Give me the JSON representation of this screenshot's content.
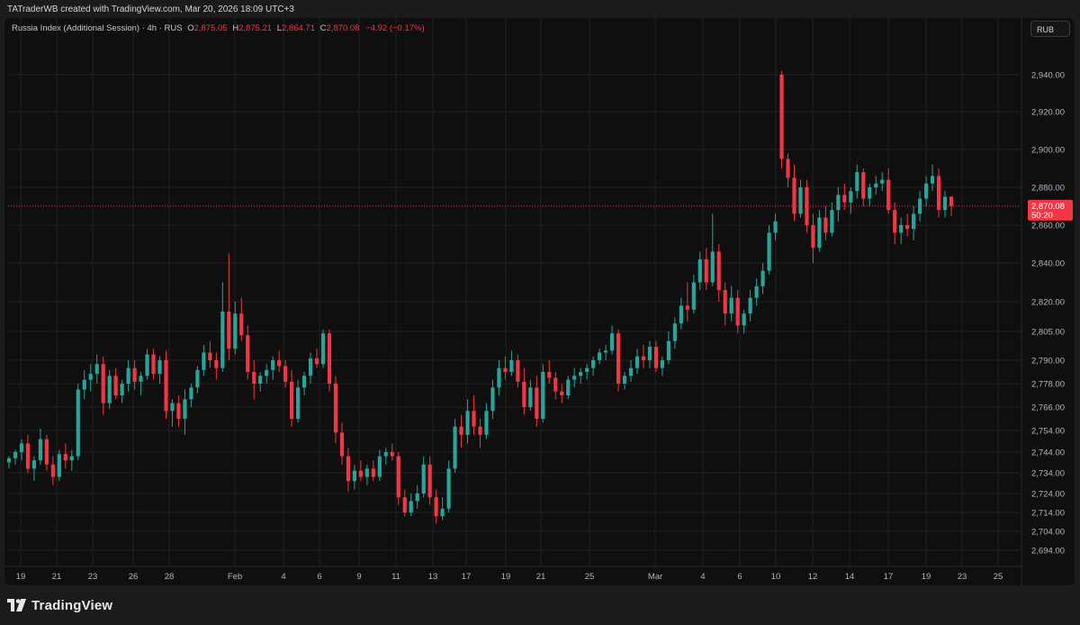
{
  "header": {
    "attribution": "TATraderWB created with TradingView.com, Mar 20, 2026 18:09 UTC+3"
  },
  "legend": {
    "symbol": "Russia Index (Additional Session) · 4h · RUS",
    "open_label": "O",
    "open": "2,875.05",
    "high_label": "H",
    "high": "2,875.21",
    "low_label": "L",
    "low": "2,864.71",
    "close_label": "C",
    "close": "2,870.08",
    "change": "−4.92 (−0.17%)"
  },
  "currency_button": "RUB",
  "price_tag": {
    "price": "2,870.08",
    "countdown": "50:20"
  },
  "footer": {
    "logo_text": "TradingView"
  },
  "colors": {
    "up": "#26a69a",
    "down": "#f23645",
    "background": "#0f0f0f",
    "grid": "#222222"
  },
  "chart_data": {
    "type": "candlestick",
    "y_axis_ticks": [
      "2,694.00",
      "2,704.00",
      "2,714.00",
      "2,724.00",
      "2,734.00",
      "2,744.00",
      "2,754.00",
      "2,766.00",
      "2,778.00",
      "2,790.00",
      "2,805.00",
      "2,820.00",
      "2,840.00",
      "2,860.00",
      "2,880.00",
      "2,900.00",
      "2,920.00",
      "2,940.00"
    ],
    "x_axis_ticks": [
      "19",
      "21",
      "23",
      "26",
      "28",
      "Feb",
      "4",
      "6",
      "9",
      "11",
      "13",
      "17",
      "19",
      "21",
      "25",
      "Mar",
      "4",
      "6",
      "10",
      "12",
      "14",
      "17",
      "19",
      "23",
      "25"
    ],
    "last_price": 2870.08,
    "series": [
      {
        "o": 2739,
        "h": 2742,
        "l": 2736,
        "c": 2741
      },
      {
        "o": 2741,
        "h": 2745,
        "l": 2738,
        "c": 2744
      },
      {
        "o": 2744,
        "h": 2750,
        "l": 2740,
        "c": 2748
      },
      {
        "o": 2748,
        "h": 2752,
        "l": 2734,
        "c": 2736
      },
      {
        "o": 2736,
        "h": 2742,
        "l": 2730,
        "c": 2740
      },
      {
        "o": 2740,
        "h": 2755,
        "l": 2738,
        "c": 2750
      },
      {
        "o": 2750,
        "h": 2752,
        "l": 2735,
        "c": 2738
      },
      {
        "o": 2738,
        "h": 2742,
        "l": 2728,
        "c": 2732
      },
      {
        "o": 2732,
        "h": 2745,
        "l": 2730,
        "c": 2743
      },
      {
        "o": 2743,
        "h": 2748,
        "l": 2736,
        "c": 2740
      },
      {
        "o": 2740,
        "h": 2745,
        "l": 2735,
        "c": 2742
      },
      {
        "o": 2742,
        "h": 2778,
        "l": 2740,
        "c": 2775
      },
      {
        "o": 2775,
        "h": 2785,
        "l": 2770,
        "c": 2780
      },
      {
        "o": 2780,
        "h": 2788,
        "l": 2774,
        "c": 2783
      },
      {
        "o": 2783,
        "h": 2793,
        "l": 2778,
        "c": 2788
      },
      {
        "o": 2788,
        "h": 2792,
        "l": 2762,
        "c": 2768
      },
      {
        "o": 2768,
        "h": 2785,
        "l": 2765,
        "c": 2782
      },
      {
        "o": 2782,
        "h": 2786,
        "l": 2770,
        "c": 2772
      },
      {
        "o": 2772,
        "h": 2780,
        "l": 2768,
        "c": 2778
      },
      {
        "o": 2778,
        "h": 2790,
        "l": 2774,
        "c": 2786
      },
      {
        "o": 2786,
        "h": 2790,
        "l": 2775,
        "c": 2779
      },
      {
        "o": 2779,
        "h": 2784,
        "l": 2772,
        "c": 2782
      },
      {
        "o": 2782,
        "h": 2796,
        "l": 2780,
        "c": 2793
      },
      {
        "o": 2793,
        "h": 2796,
        "l": 2780,
        "c": 2783
      },
      {
        "o": 2783,
        "h": 2792,
        "l": 2778,
        "c": 2790
      },
      {
        "o": 2790,
        "h": 2795,
        "l": 2760,
        "c": 2764
      },
      {
        "o": 2764,
        "h": 2770,
        "l": 2756,
        "c": 2768
      },
      {
        "o": 2768,
        "h": 2772,
        "l": 2756,
        "c": 2760
      },
      {
        "o": 2760,
        "h": 2775,
        "l": 2752,
        "c": 2770
      },
      {
        "o": 2770,
        "h": 2778,
        "l": 2766,
        "c": 2776
      },
      {
        "o": 2776,
        "h": 2787,
        "l": 2773,
        "c": 2785
      },
      {
        "o": 2785,
        "h": 2798,
        "l": 2782,
        "c": 2794
      },
      {
        "o": 2794,
        "h": 2800,
        "l": 2786,
        "c": 2790
      },
      {
        "o": 2790,
        "h": 2794,
        "l": 2780,
        "c": 2786
      },
      {
        "o": 2786,
        "h": 2830,
        "l": 2784,
        "c": 2815
      },
      {
        "o": 2815,
        "h": 2845,
        "l": 2790,
        "c": 2796
      },
      {
        "o": 2796,
        "h": 2820,
        "l": 2793,
        "c": 2814
      },
      {
        "o": 2814,
        "h": 2822,
        "l": 2800,
        "c": 2803
      },
      {
        "o": 2803,
        "h": 2808,
        "l": 2780,
        "c": 2784
      },
      {
        "o": 2784,
        "h": 2790,
        "l": 2770,
        "c": 2778
      },
      {
        "o": 2778,
        "h": 2784,
        "l": 2774,
        "c": 2782
      },
      {
        "o": 2782,
        "h": 2788,
        "l": 2778,
        "c": 2785
      },
      {
        "o": 2785,
        "h": 2792,
        "l": 2780,
        "c": 2790
      },
      {
        "o": 2790,
        "h": 2795,
        "l": 2784,
        "c": 2787
      },
      {
        "o": 2787,
        "h": 2790,
        "l": 2776,
        "c": 2779
      },
      {
        "o": 2779,
        "h": 2785,
        "l": 2756,
        "c": 2760
      },
      {
        "o": 2760,
        "h": 2780,
        "l": 2758,
        "c": 2776
      },
      {
        "o": 2776,
        "h": 2784,
        "l": 2772,
        "c": 2782
      },
      {
        "o": 2782,
        "h": 2794,
        "l": 2778,
        "c": 2791
      },
      {
        "o": 2791,
        "h": 2796,
        "l": 2786,
        "c": 2788
      },
      {
        "o": 2788,
        "h": 2806,
        "l": 2786,
        "c": 2804
      },
      {
        "o": 2804,
        "h": 2806,
        "l": 2774,
        "c": 2778
      },
      {
        "o": 2778,
        "h": 2782,
        "l": 2748,
        "c": 2753
      },
      {
        "o": 2753,
        "h": 2758,
        "l": 2738,
        "c": 2742
      },
      {
        "o": 2742,
        "h": 2746,
        "l": 2725,
        "c": 2730
      },
      {
        "o": 2730,
        "h": 2738,
        "l": 2726,
        "c": 2735
      },
      {
        "o": 2735,
        "h": 2740,
        "l": 2730,
        "c": 2732
      },
      {
        "o": 2732,
        "h": 2738,
        "l": 2728,
        "c": 2736
      },
      {
        "o": 2736,
        "h": 2740,
        "l": 2730,
        "c": 2732
      },
      {
        "o": 2732,
        "h": 2745,
        "l": 2730,
        "c": 2742
      },
      {
        "o": 2742,
        "h": 2746,
        "l": 2738,
        "c": 2744
      },
      {
        "o": 2744,
        "h": 2748,
        "l": 2740,
        "c": 2742
      },
      {
        "o": 2742,
        "h": 2744,
        "l": 2718,
        "c": 2722
      },
      {
        "o": 2722,
        "h": 2726,
        "l": 2712,
        "c": 2714
      },
      {
        "o": 2714,
        "h": 2724,
        "l": 2712,
        "c": 2720
      },
      {
        "o": 2720,
        "h": 2728,
        "l": 2716,
        "c": 2724
      },
      {
        "o": 2724,
        "h": 2742,
        "l": 2722,
        "c": 2738
      },
      {
        "o": 2738,
        "h": 2742,
        "l": 2718,
        "c": 2722
      },
      {
        "o": 2722,
        "h": 2726,
        "l": 2708,
        "c": 2712
      },
      {
        "o": 2712,
        "h": 2722,
        "l": 2710,
        "c": 2716
      },
      {
        "o": 2716,
        "h": 2740,
        "l": 2714,
        "c": 2736
      },
      {
        "o": 2736,
        "h": 2760,
        "l": 2734,
        "c": 2756
      },
      {
        "o": 2756,
        "h": 2762,
        "l": 2746,
        "c": 2752
      },
      {
        "o": 2752,
        "h": 2770,
        "l": 2748,
        "c": 2764
      },
      {
        "o": 2764,
        "h": 2772,
        "l": 2752,
        "c": 2756
      },
      {
        "o": 2756,
        "h": 2760,
        "l": 2746,
        "c": 2752
      },
      {
        "o": 2752,
        "h": 2768,
        "l": 2750,
        "c": 2764
      },
      {
        "o": 2764,
        "h": 2780,
        "l": 2760,
        "c": 2776
      },
      {
        "o": 2776,
        "h": 2790,
        "l": 2772,
        "c": 2786
      },
      {
        "o": 2786,
        "h": 2792,
        "l": 2780,
        "c": 2784
      },
      {
        "o": 2784,
        "h": 2795,
        "l": 2782,
        "c": 2790
      },
      {
        "o": 2790,
        "h": 2793,
        "l": 2776,
        "c": 2779
      },
      {
        "o": 2779,
        "h": 2786,
        "l": 2762,
        "c": 2766
      },
      {
        "o": 2766,
        "h": 2780,
        "l": 2764,
        "c": 2776
      },
      {
        "o": 2776,
        "h": 2782,
        "l": 2756,
        "c": 2760
      },
      {
        "o": 2760,
        "h": 2788,
        "l": 2758,
        "c": 2784
      },
      {
        "o": 2784,
        "h": 2790,
        "l": 2778,
        "c": 2781
      },
      {
        "o": 2781,
        "h": 2784,
        "l": 2770,
        "c": 2774
      },
      {
        "o": 2774,
        "h": 2778,
        "l": 2768,
        "c": 2772
      },
      {
        "o": 2772,
        "h": 2782,
        "l": 2770,
        "c": 2780
      },
      {
        "o": 2780,
        "h": 2786,
        "l": 2776,
        "c": 2782
      },
      {
        "o": 2782,
        "h": 2786,
        "l": 2778,
        "c": 2784
      },
      {
        "o": 2784,
        "h": 2788,
        "l": 2780,
        "c": 2786
      },
      {
        "o": 2786,
        "h": 2792,
        "l": 2782,
        "c": 2790
      },
      {
        "o": 2790,
        "h": 2796,
        "l": 2788,
        "c": 2794
      },
      {
        "o": 2794,
        "h": 2798,
        "l": 2790,
        "c": 2795
      },
      {
        "o": 2795,
        "h": 2808,
        "l": 2793,
        "c": 2804
      },
      {
        "o": 2804,
        "h": 2806,
        "l": 2774,
        "c": 2778
      },
      {
        "o": 2778,
        "h": 2784,
        "l": 2775,
        "c": 2782
      },
      {
        "o": 2782,
        "h": 2790,
        "l": 2779,
        "c": 2786
      },
      {
        "o": 2786,
        "h": 2796,
        "l": 2783,
        "c": 2792
      },
      {
        "o": 2792,
        "h": 2798,
        "l": 2786,
        "c": 2790
      },
      {
        "o": 2790,
        "h": 2800,
        "l": 2786,
        "c": 2797
      },
      {
        "o": 2797,
        "h": 2800,
        "l": 2784,
        "c": 2786
      },
      {
        "o": 2786,
        "h": 2792,
        "l": 2782,
        "c": 2790
      },
      {
        "o": 2790,
        "h": 2805,
        "l": 2788,
        "c": 2800
      },
      {
        "o": 2800,
        "h": 2812,
        "l": 2796,
        "c": 2809
      },
      {
        "o": 2809,
        "h": 2822,
        "l": 2806,
        "c": 2818
      },
      {
        "o": 2818,
        "h": 2830,
        "l": 2810,
        "c": 2816
      },
      {
        "o": 2816,
        "h": 2834,
        "l": 2814,
        "c": 2830
      },
      {
        "o": 2830,
        "h": 2846,
        "l": 2826,
        "c": 2842
      },
      {
        "o": 2842,
        "h": 2848,
        "l": 2826,
        "c": 2830
      },
      {
        "o": 2830,
        "h": 2866,
        "l": 2828,
        "c": 2846
      },
      {
        "o": 2846,
        "h": 2850,
        "l": 2820,
        "c": 2826
      },
      {
        "o": 2826,
        "h": 2830,
        "l": 2808,
        "c": 2814
      },
      {
        "o": 2814,
        "h": 2828,
        "l": 2810,
        "c": 2822
      },
      {
        "o": 2822,
        "h": 2826,
        "l": 2804,
        "c": 2808
      },
      {
        "o": 2808,
        "h": 2816,
        "l": 2804,
        "c": 2814
      },
      {
        "o": 2814,
        "h": 2826,
        "l": 2810,
        "c": 2822
      },
      {
        "o": 2822,
        "h": 2832,
        "l": 2818,
        "c": 2828
      },
      {
        "o": 2828,
        "h": 2840,
        "l": 2824,
        "c": 2836
      },
      {
        "o": 2836,
        "h": 2860,
        "l": 2834,
        "c": 2856
      },
      {
        "o": 2856,
        "h": 2866,
        "l": 2852,
        "c": 2862
      },
      {
        "o": 2940,
        "h": 2942,
        "l": 2890,
        "c": 2895
      },
      {
        "o": 2895,
        "h": 2898,
        "l": 2880,
        "c": 2885
      },
      {
        "o": 2885,
        "h": 2892,
        "l": 2862,
        "c": 2866
      },
      {
        "o": 2866,
        "h": 2884,
        "l": 2864,
        "c": 2880
      },
      {
        "o": 2880,
        "h": 2884,
        "l": 2856,
        "c": 2860
      },
      {
        "o": 2860,
        "h": 2866,
        "l": 2840,
        "c": 2848
      },
      {
        "o": 2848,
        "h": 2868,
        "l": 2846,
        "c": 2864
      },
      {
        "o": 2864,
        "h": 2870,
        "l": 2852,
        "c": 2856
      },
      {
        "o": 2856,
        "h": 2872,
        "l": 2854,
        "c": 2868
      },
      {
        "o": 2868,
        "h": 2880,
        "l": 2862,
        "c": 2876
      },
      {
        "o": 2876,
        "h": 2882,
        "l": 2868,
        "c": 2872
      },
      {
        "o": 2872,
        "h": 2880,
        "l": 2866,
        "c": 2878
      },
      {
        "o": 2878,
        "h": 2892,
        "l": 2874,
        "c": 2888
      },
      {
        "o": 2888,
        "h": 2890,
        "l": 2870,
        "c": 2874
      },
      {
        "o": 2874,
        "h": 2882,
        "l": 2870,
        "c": 2880
      },
      {
        "o": 2880,
        "h": 2886,
        "l": 2876,
        "c": 2882
      },
      {
        "o": 2882,
        "h": 2888,
        "l": 2878,
        "c": 2884
      },
      {
        "o": 2884,
        "h": 2890,
        "l": 2866,
        "c": 2868
      },
      {
        "o": 2868,
        "h": 2872,
        "l": 2850,
        "c": 2856
      },
      {
        "o": 2856,
        "h": 2864,
        "l": 2850,
        "c": 2860
      },
      {
        "o": 2860,
        "h": 2866,
        "l": 2854,
        "c": 2858
      },
      {
        "o": 2858,
        "h": 2870,
        "l": 2852,
        "c": 2866
      },
      {
        "o": 2866,
        "h": 2878,
        "l": 2862,
        "c": 2874
      },
      {
        "o": 2874,
        "h": 2886,
        "l": 2870,
        "c": 2882
      },
      {
        "o": 2882,
        "h": 2892,
        "l": 2878,
        "c": 2886
      },
      {
        "o": 2886,
        "h": 2890,
        "l": 2864,
        "c": 2868
      },
      {
        "o": 2868,
        "h": 2878,
        "l": 2864,
        "c": 2875
      },
      {
        "o": 2875.05,
        "h": 2875.21,
        "l": 2864.71,
        "c": 2870.08
      }
    ]
  }
}
